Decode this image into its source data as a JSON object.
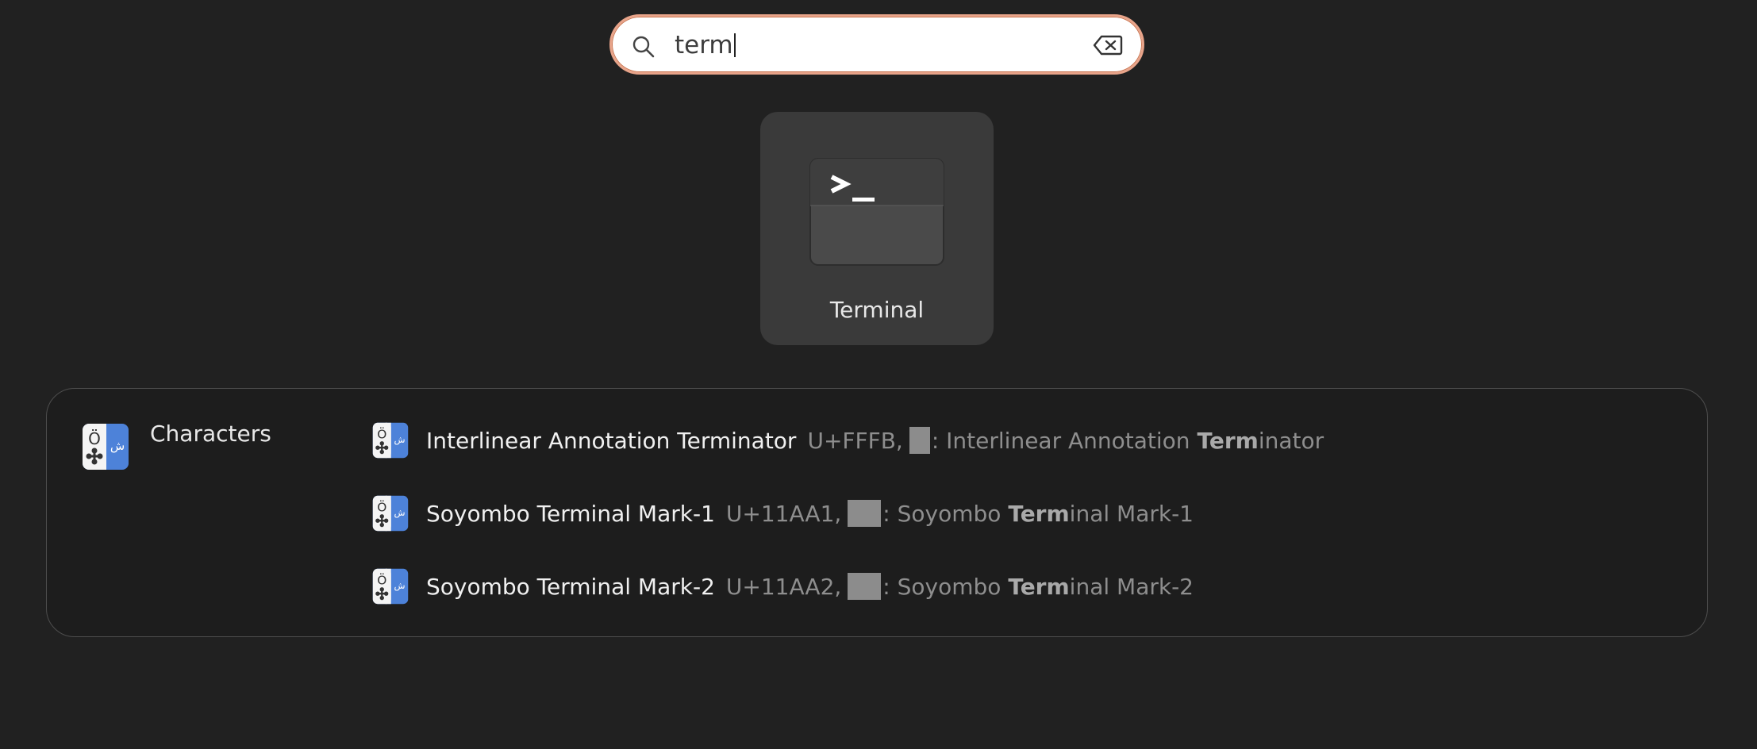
{
  "search": {
    "value": "term"
  },
  "app_results": [
    {
      "label": "Terminal",
      "icon": "terminal-icon"
    }
  ],
  "provider": {
    "name": "Characters",
    "icon": "characters-app-icon",
    "results": [
      {
        "title": "Interlinear Annotation Terminator",
        "codepoint": "U+FFFB,",
        "desc_before": ": Interlinear Annotation ",
        "desc_match": "Term",
        "desc_after": "inator"
      },
      {
        "title": "Soyombo Terminal Mark-1",
        "codepoint": "U+11AA1,",
        "desc_before": ": Soyombo ",
        "desc_match": "Term",
        "desc_after": "inal Mark-1"
      },
      {
        "title": "Soyombo Terminal Mark-2",
        "codepoint": "U+11AA2,",
        "desc_before": ": Soyombo ",
        "desc_match": "Term",
        "desc_after": "inal Mark-2"
      }
    ]
  },
  "colors": {
    "background": "#212121",
    "search_border": "#e8a48a",
    "tile": "#3a3a3a",
    "characters_blue": "#4a7fd6"
  }
}
